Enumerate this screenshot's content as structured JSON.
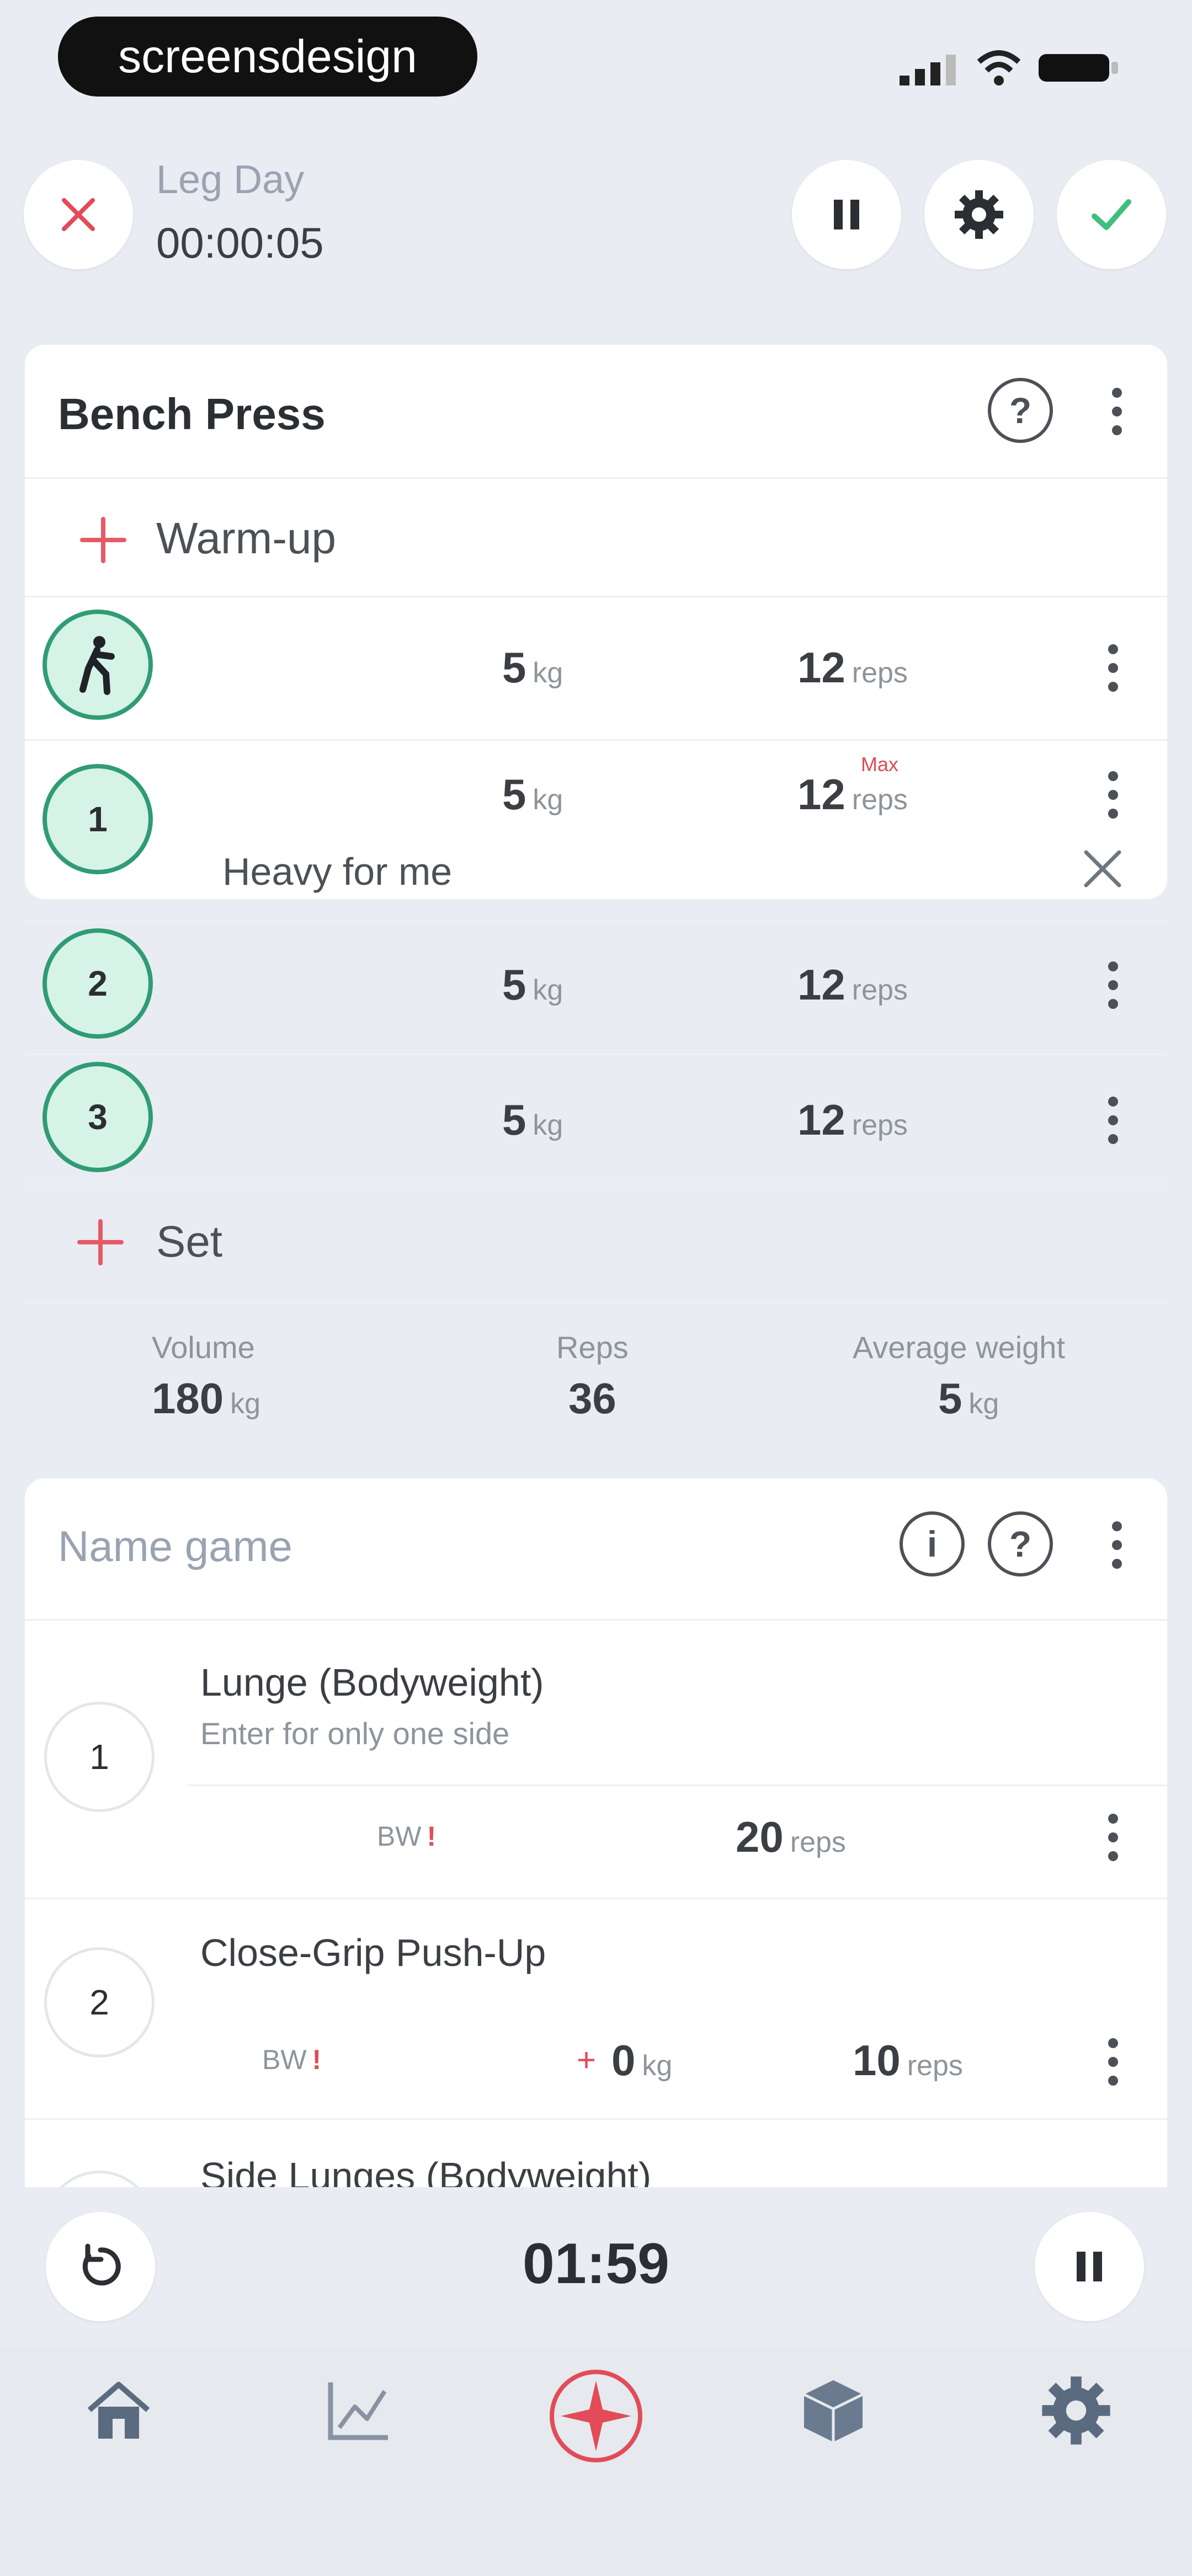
{
  "status_bar": {
    "brand": "screensdesign"
  },
  "header": {
    "title": "Leg Day",
    "elapsed": "00:00:05"
  },
  "exercise1": {
    "name": "Bench Press",
    "warmup_label": "Warm-up",
    "sets": [
      {
        "badge": "",
        "weight": "5",
        "weight_unit": "kg",
        "reps": "12",
        "reps_unit": "reps",
        "tag": ""
      },
      {
        "badge": "1",
        "weight": "5",
        "weight_unit": "kg",
        "reps": "12",
        "reps_unit": "reps",
        "tag": "Max",
        "note": "Heavy for me"
      },
      {
        "badge": "2",
        "weight": "5",
        "weight_unit": "kg",
        "reps": "12",
        "reps_unit": "reps",
        "tag": ""
      },
      {
        "badge": "3",
        "weight": "5",
        "weight_unit": "kg",
        "reps": "12",
        "reps_unit": "reps",
        "tag": ""
      }
    ],
    "add_set_label": "Set",
    "summary": {
      "volume_label": "Volume",
      "volume_value": "180",
      "volume_unit": "kg",
      "reps_label": "Reps",
      "reps_value": "36",
      "avg_label": "Average weight",
      "avg_value": "5",
      "avg_unit": "kg"
    }
  },
  "exercise2": {
    "name": "Name game",
    "info_icon_glyph": "i",
    "help_icon_glyph": "?",
    "items": [
      {
        "num": "1",
        "name": "Lunge (Bodyweight)",
        "hint": "Enter for only one side",
        "bw": "BW",
        "bw_flag": "!",
        "reps": "20",
        "reps_unit": "reps"
      },
      {
        "num": "2",
        "name": "Close-Grip Push-Up",
        "bw": "BW",
        "bw_flag": "!",
        "plus_sign": "+",
        "extra_weight": "0",
        "extra_unit": "kg",
        "reps": "10",
        "reps_unit": "reps"
      },
      {
        "num": "",
        "name": "Side Lunges (Bodyweight)"
      }
    ]
  },
  "timer": {
    "value": "01:59"
  },
  "help_glyph": "?"
}
